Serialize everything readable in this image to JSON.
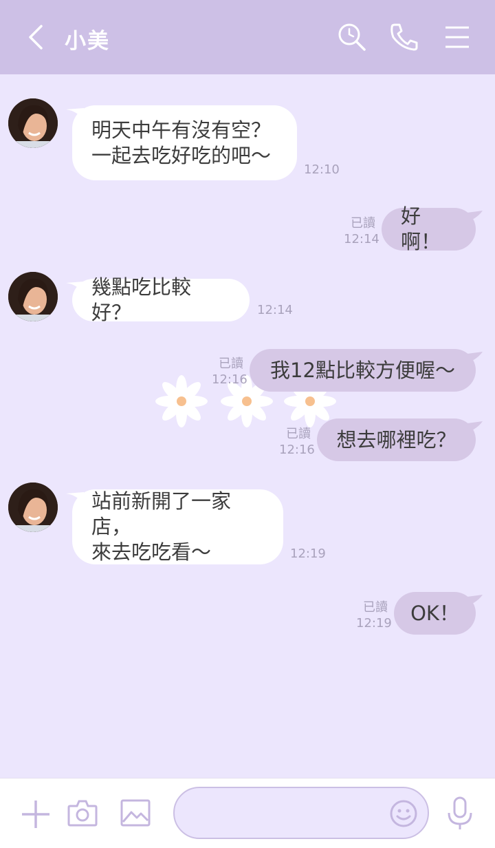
{
  "header": {
    "title": "小美",
    "icons": [
      "back-chevron-icon",
      "search-history-icon",
      "phone-icon",
      "menu-icon"
    ]
  },
  "messages": [
    {
      "side": "in",
      "text": "明天中午有沒有空？\n一起去吃好吃的吧～",
      "time": "12:10"
    },
    {
      "side": "out",
      "text": "好啊！",
      "read": "已讀",
      "time": "12:14"
    },
    {
      "side": "in",
      "text": "幾點吃比較好？",
      "time": "12:14"
    },
    {
      "side": "out",
      "text": "我12點比較方便喔～",
      "read": "已讀",
      "time": "12:16"
    },
    {
      "side": "out",
      "text": "想去哪裡吃？",
      "read": "已讀",
      "time": "12:16"
    },
    {
      "side": "in",
      "text": "站前新開了一家店，\n來去吃吃看～",
      "time": "12:19"
    },
    {
      "side": "out",
      "text": "OK！",
      "read": "已讀",
      "time": "12:19"
    }
  ],
  "footer": {
    "icons": [
      "plus-icon",
      "camera-icon",
      "image-icon",
      "emoji-icon",
      "microphone-icon"
    ],
    "input_value": ""
  },
  "colors": {
    "header_bg": "#cdc0e6",
    "chat_bg": "#ece6fd",
    "out_bubble": "#d6c8e6",
    "in_bubble": "#ffffff",
    "accent": "#b7a6d8"
  }
}
